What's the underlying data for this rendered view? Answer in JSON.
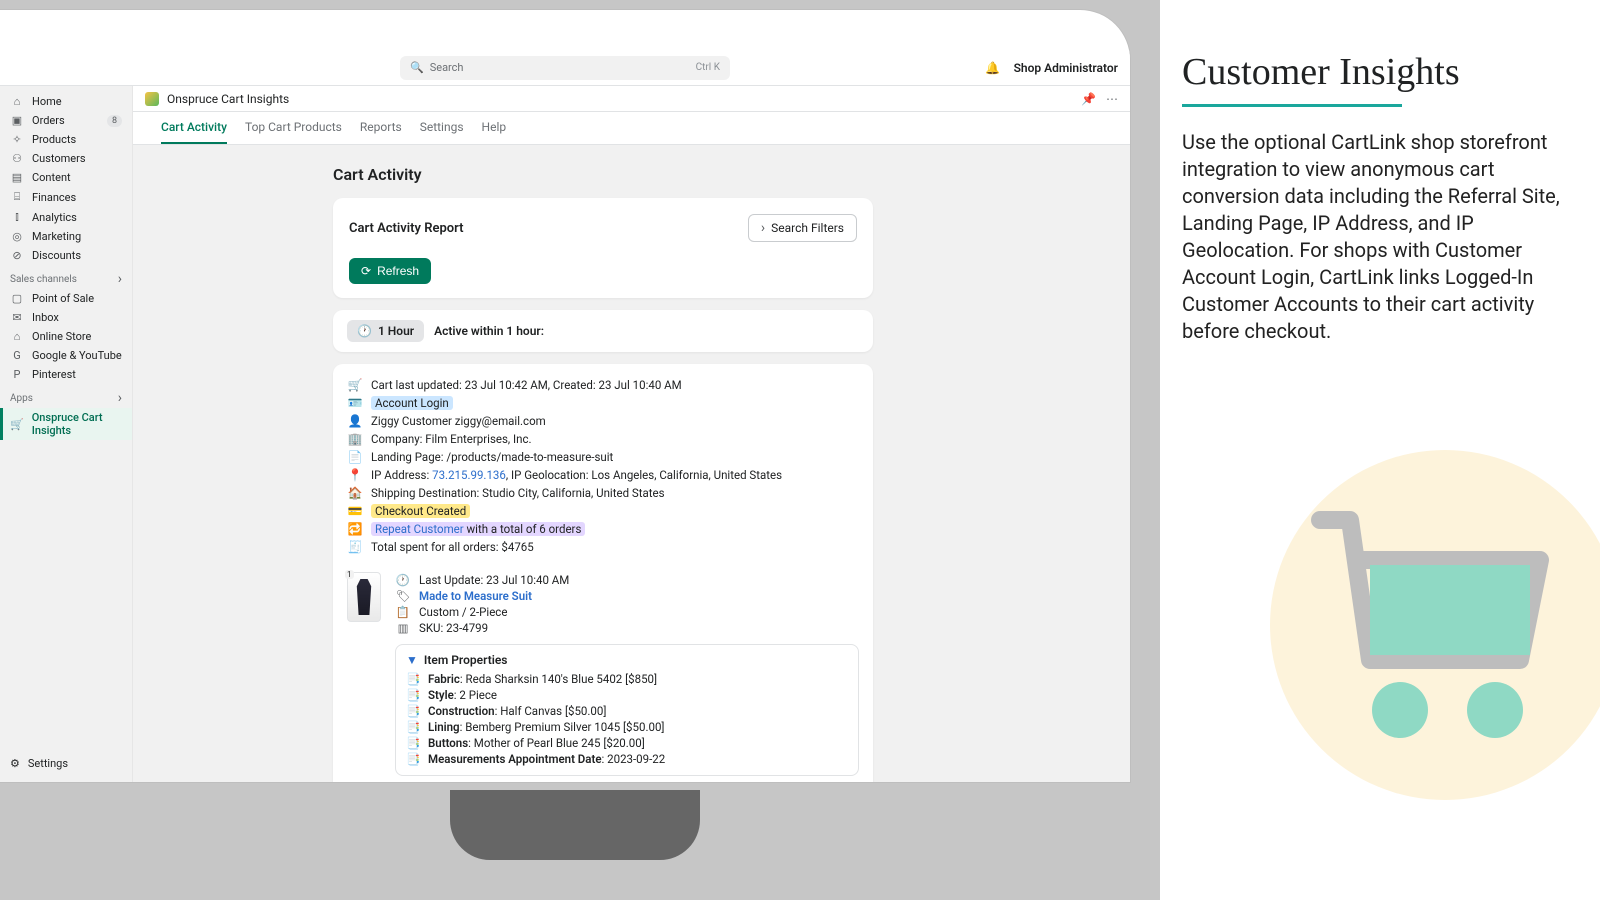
{
  "topbar": {
    "search_placeholder": "Search",
    "search_kbd": "Ctrl K",
    "shop_admin": "Shop Administrator"
  },
  "sidebar": {
    "items": [
      {
        "icon": "⌂",
        "label": "Home"
      },
      {
        "icon": "▣",
        "label": "Orders",
        "badge": "8"
      },
      {
        "icon": "✧",
        "label": "Products"
      },
      {
        "icon": "⚇",
        "label": "Customers"
      },
      {
        "icon": "▤",
        "label": "Content"
      },
      {
        "icon": "⌸",
        "label": "Finances"
      },
      {
        "icon": "⫾",
        "label": "Analytics"
      },
      {
        "icon": "◎",
        "label": "Marketing"
      },
      {
        "icon": "⊘",
        "label": "Discounts"
      }
    ],
    "sales_channels_label": "Sales channels",
    "sales_channels": [
      {
        "icon": "▢",
        "label": "Point of Sale"
      },
      {
        "icon": "✉",
        "label": "Inbox"
      },
      {
        "icon": "⌂",
        "label": "Online Store"
      },
      {
        "icon": "G",
        "label": "Google & YouTube"
      },
      {
        "icon": "P",
        "label": "Pinterest"
      }
    ],
    "apps_label": "Apps",
    "apps": [
      {
        "icon": "🛒",
        "label": "Onspruce Cart Insights"
      }
    ],
    "settings_label": "Settings"
  },
  "app": {
    "name": "Onspruce Cart Insights",
    "tabs": [
      "Cart Activity",
      "Top Cart Products",
      "Reports",
      "Settings",
      "Help"
    ],
    "active_tab": 0
  },
  "page": {
    "title": "Cart Activity",
    "report_title": "Cart Activity Report",
    "search_filters": "Search Filters",
    "refresh": "Refresh",
    "time_chip": "1 Hour",
    "time_desc": "Active within 1 hour:"
  },
  "cart": {
    "updated": "Cart last updated: 23 Jul 10:42 AM, Created: 23 Jul 10:40 AM",
    "account_login": "Account Login",
    "customer": "Ziggy Customer ziggy@email.com",
    "company": "Company: Film Enterprises, Inc.",
    "landing": "Landing Page: /products/made-to-measure-suit",
    "ip_prefix": "IP Address: ",
    "ip": "73.215.99.136",
    "ip_suffix": ", IP Geolocation: Los Angeles, California, United States",
    "shipping": "Shipping Destination: Studio City, California, United States",
    "checkout": "Checkout Created",
    "repeat_prefix": "Repeat Customer",
    "repeat_suffix": " with a total of 6 orders",
    "total_spent": "Total spent for all orders: $4765"
  },
  "product": {
    "badge_num": "1",
    "last_update": "Last Update: 23 Jul 10:40 AM",
    "name": "Made to Measure Suit",
    "variant": "Custom / 2-Piece",
    "sku": "SKU: 23-4799",
    "props_header": "Item Properties",
    "props": [
      {
        "k": "Fabric",
        "v": "Reda Sharksin 140's Blue 5402 [$850]"
      },
      {
        "k": "Style",
        "v": "2 Piece"
      },
      {
        "k": "Construction",
        "v": "Half Canvas [$50.00]"
      },
      {
        "k": "Lining",
        "v": "Bemberg Premium Silver 1045 [$50.00]"
      },
      {
        "k": "Buttons",
        "v": "Mother of Pearl Blue 245 [$20.00]"
      },
      {
        "k": "Measurements Appointment Date",
        "v": "2023-09-22"
      }
    ]
  },
  "rightpanel": {
    "title": "Customer Insights",
    "body": "Use the optional CartLink shop storefront integration to view anonymous cart conversion data including the Referral Site, Landing Page, IP Address, and IP Geolocation.  For shops with Customer Account Login, CartLink links Logged-In Customer Accounts to their cart activity before checkout."
  }
}
